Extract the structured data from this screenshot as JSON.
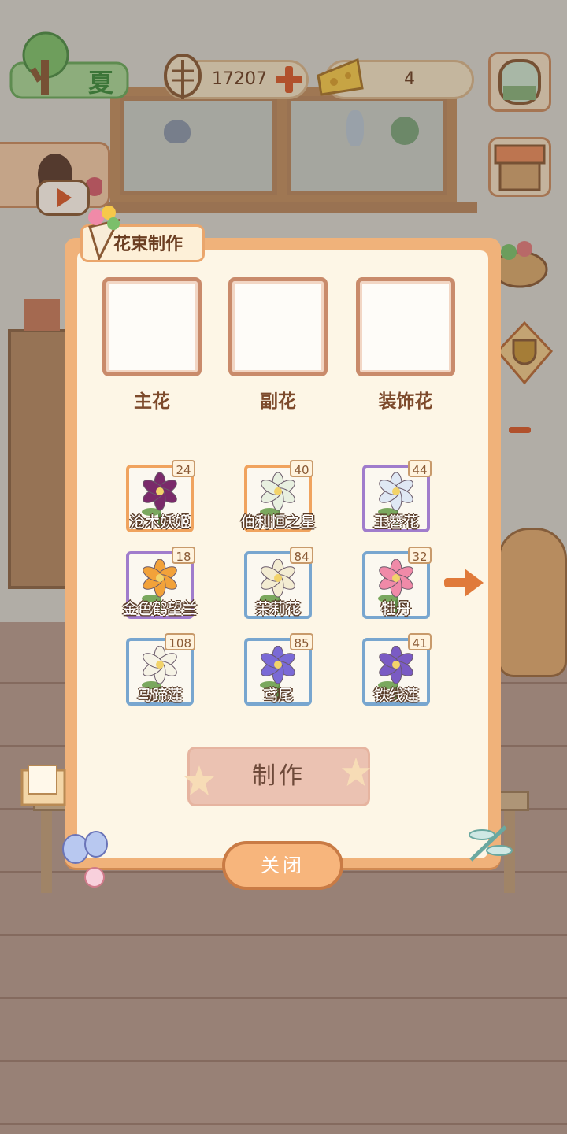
{
  "season": {
    "label": "夏"
  },
  "currency": {
    "coins": "17207",
    "cheese": "4"
  },
  "panel": {
    "title": "花束制作",
    "slots": [
      {
        "label": "主花"
      },
      {
        "label": "副花"
      },
      {
        "label": "装饰花"
      }
    ],
    "flowers": [
      {
        "name": "沧木妖姬",
        "count": "24",
        "rarity": "orange",
        "color": "#7a2a6a"
      },
      {
        "name": "伯利恒之星",
        "count": "40",
        "rarity": "orange",
        "color": "#e8f0e0"
      },
      {
        "name": "玉簪花",
        "count": "44",
        "rarity": "purple",
        "color": "#dfe8f4"
      },
      {
        "name": "金色鹤望兰",
        "count": "18",
        "rarity": "purple",
        "color": "#f2a23a"
      },
      {
        "name": "茉莉花",
        "count": "84",
        "rarity": "blue",
        "color": "#f3ecd2"
      },
      {
        "name": "牡丹",
        "count": "32",
        "rarity": "blue",
        "color": "#f08aa8"
      },
      {
        "name": "马蹄莲",
        "count": "108",
        "rarity": "blue",
        "color": "#f6f3e6"
      },
      {
        "name": "鸢尾",
        "count": "85",
        "rarity": "blue",
        "color": "#7a6ad6"
      },
      {
        "name": "铁线莲",
        "count": "41",
        "rarity": "blue",
        "color": "#7a5bc4"
      }
    ],
    "make_label": "制作",
    "close_label": "关闭"
  },
  "colors": {
    "panel_border": "#f0b27a",
    "panel_bg": "#fdf6e6",
    "accent": "#e07a3a"
  },
  "icons": [
    "tree-season-icon",
    "fishbone-icon",
    "plus-icon",
    "cheese-icon",
    "window-icon",
    "shop-awning-icon",
    "basket-icon",
    "trophy-icon",
    "minus-icon",
    "play-icon",
    "arrow-right-icon",
    "bouquet-icon",
    "butterfly-icon",
    "dragonfly-icon",
    "note-icon"
  ]
}
